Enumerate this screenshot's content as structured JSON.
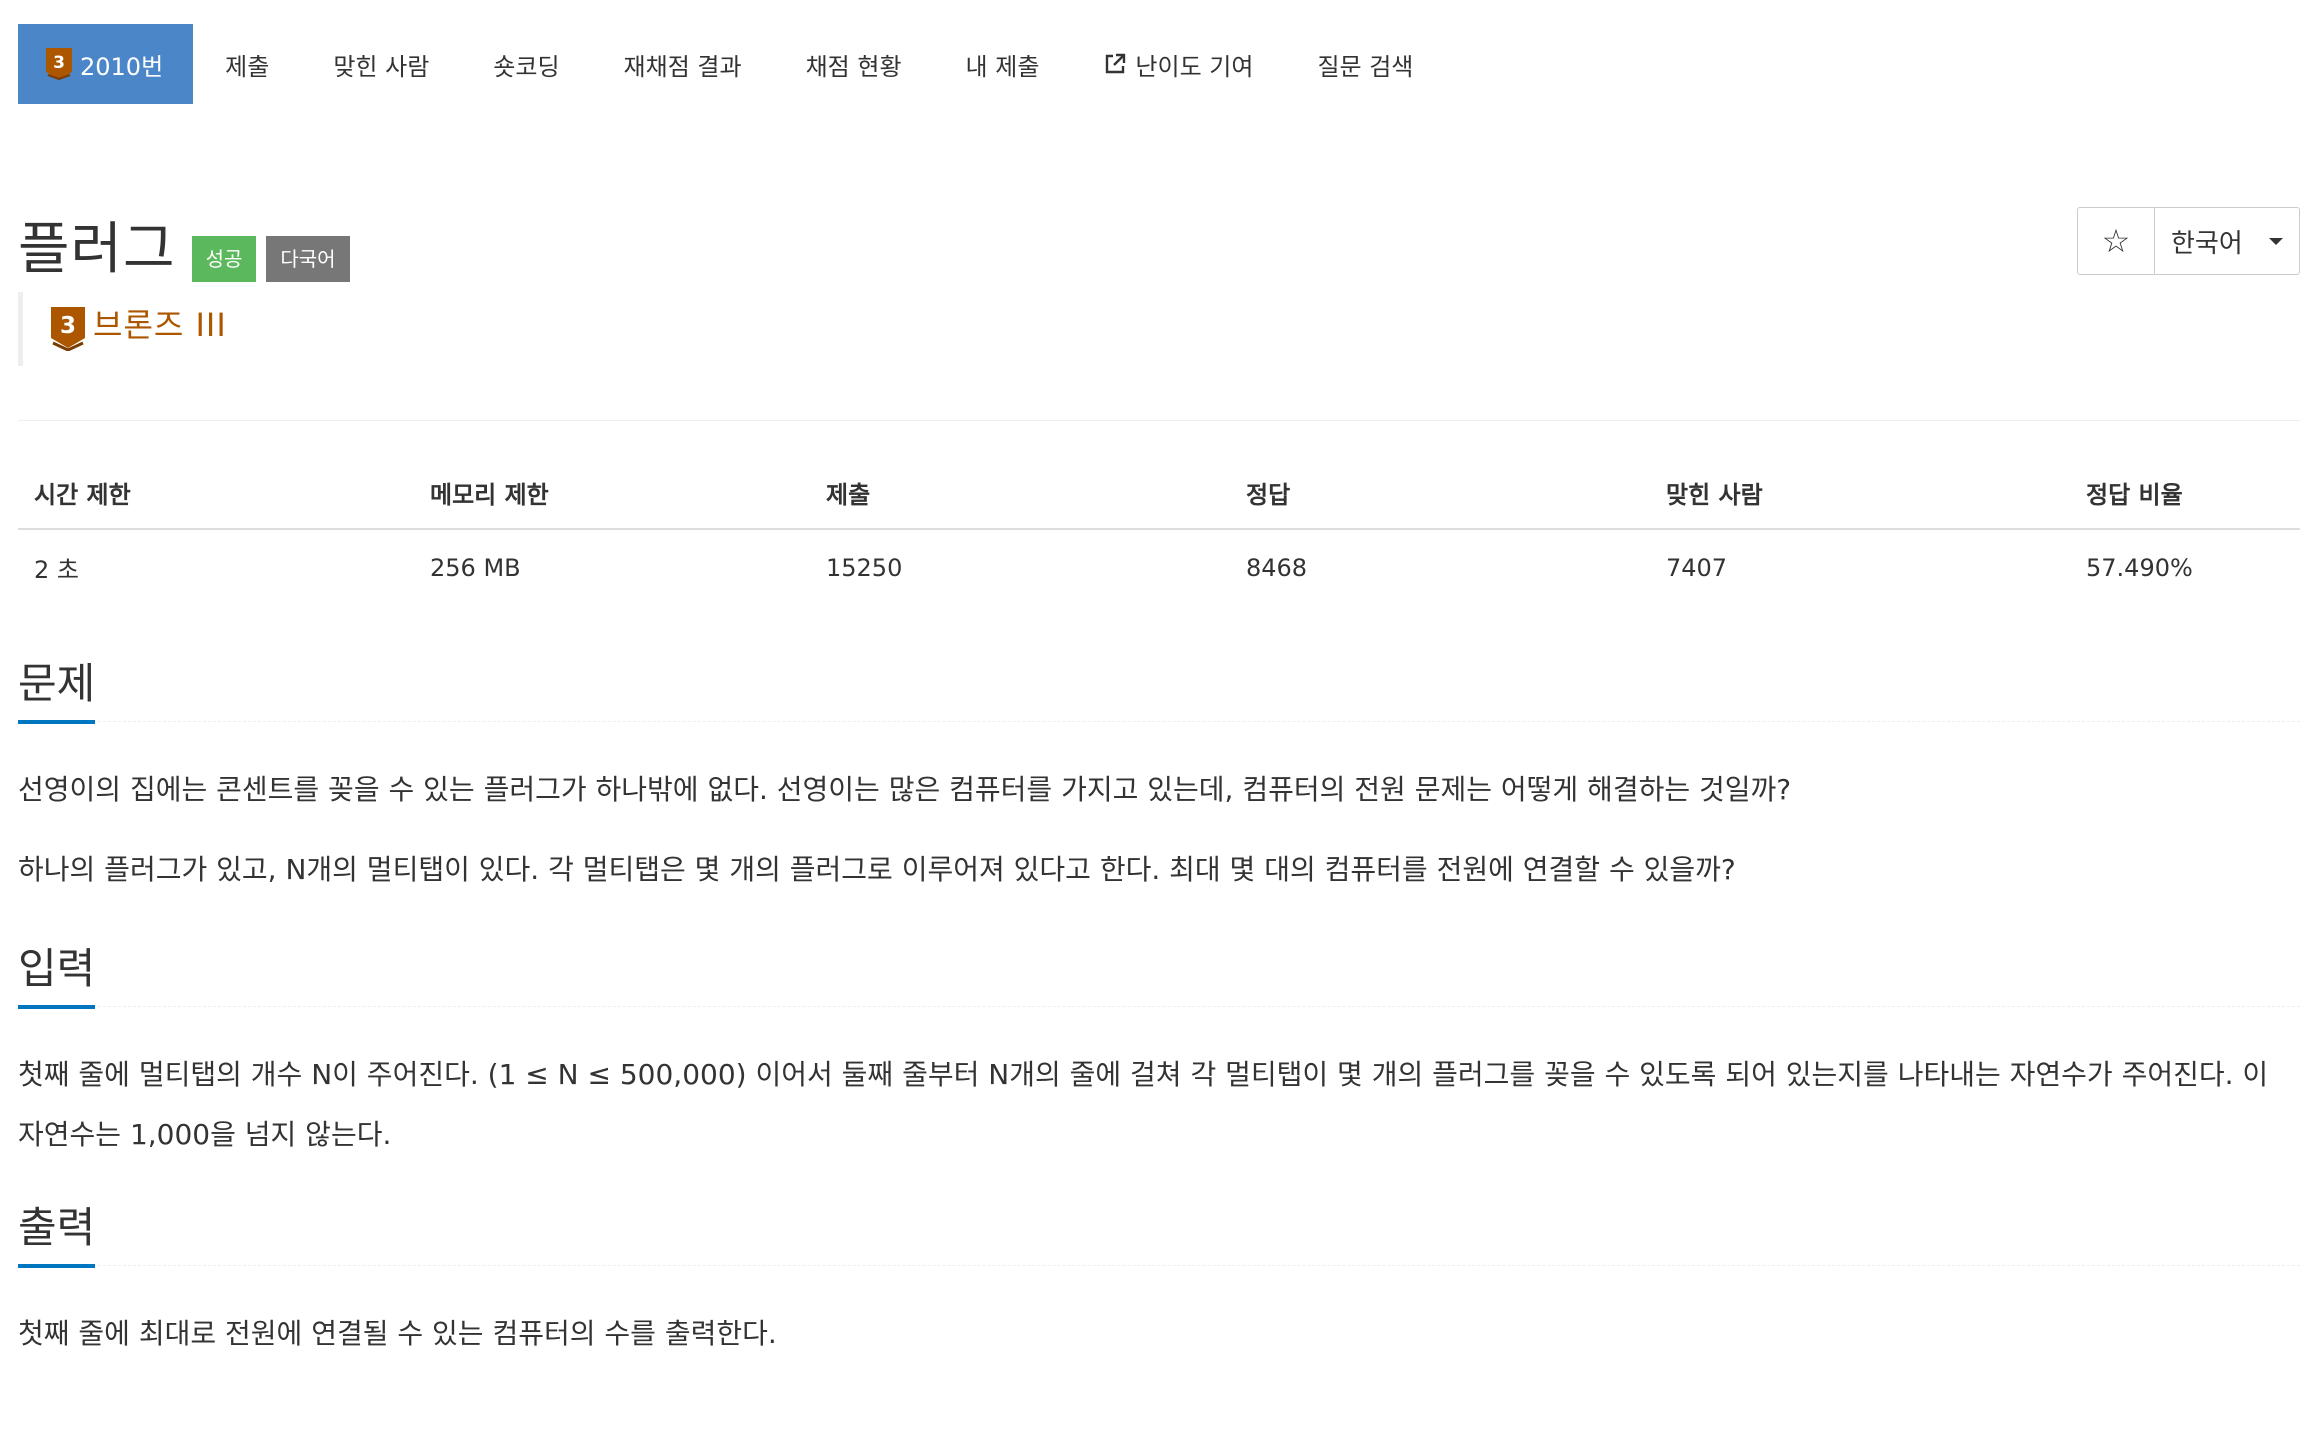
{
  "nav": {
    "items": [
      {
        "label": "2010번",
        "tier_digit": "3"
      },
      {
        "label": "제출"
      },
      {
        "label": "맞힌 사람"
      },
      {
        "label": "숏코딩"
      },
      {
        "label": "재채점 결과"
      },
      {
        "label": "채점 현황"
      },
      {
        "label": "내 제출"
      },
      {
        "label": "난이도 기여"
      },
      {
        "label": "질문 검색"
      }
    ]
  },
  "problem": {
    "title": "플러그",
    "labels": {
      "success": "성공",
      "multilang": "다국어"
    },
    "tier": {
      "digit": "3",
      "text": "브론즈 III"
    },
    "language": "한국어",
    "star": "☆"
  },
  "info": {
    "headers": [
      "시간 제한",
      "메모리 제한",
      "제출",
      "정답",
      "맞힌 사람",
      "정답 비율"
    ],
    "values": [
      "2 초",
      "256 MB",
      "15250",
      "8468",
      "7407",
      "57.490%"
    ]
  },
  "sections": {
    "description": {
      "title": "문제",
      "paragraphs": [
        "선영이의 집에는 콘센트를 꽂을 수 있는 플러그가 하나밖에 없다. 선영이는 많은 컴퓨터를 가지고 있는데, 컴퓨터의 전원 문제는 어떻게 해결하는 것일까?",
        "하나의 플러그가 있고, N개의 멀티탭이 있다. 각 멀티탭은 몇 개의 플러그로 이루어져 있다고 한다. 최대 몇 대의 컴퓨터를 전원에 연결할 수 있을까?"
      ]
    },
    "input": {
      "title": "입력",
      "paragraphs": [
        "첫째 줄에 멀티탭의 개수 N이 주어진다. (1 ≤ N ≤ 500,000) 이어서 둘째 줄부터 N개의 줄에 걸쳐 각 멀티탭이 몇 개의 플러그를 꽂을 수 있도록 되어 있는지를 나타내는 자연수가 주어진다. 이 자연수는 1,000을 넘지 않는다."
      ]
    },
    "output": {
      "title": "출력",
      "paragraphs": [
        "첫째 줄에 최대로 전원에 연결될 수 있는 컴퓨터의 수를 출력한다."
      ]
    }
  },
  "colors": {
    "nav_active": "#4a86c8",
    "tier_bronze": "#ad5600",
    "label_success": "#5cb85c",
    "label_default": "#777777",
    "section_underline": "#0076c0"
  }
}
